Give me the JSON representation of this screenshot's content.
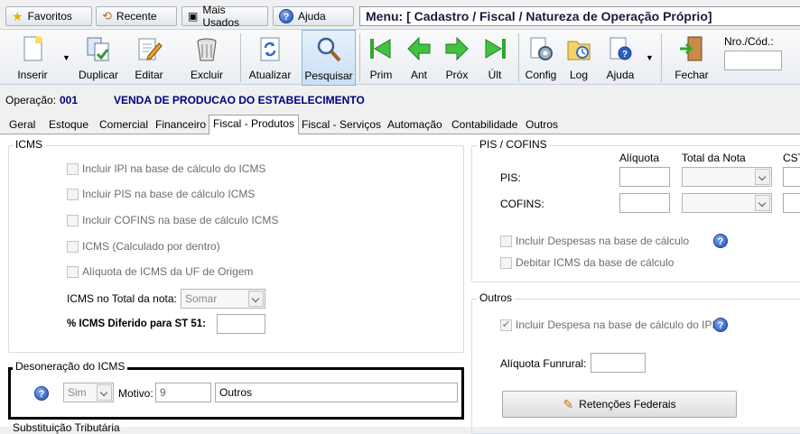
{
  "topbar": {
    "favoritos": "Favoritos",
    "recente": "Recente",
    "mais_usados": "Mais Usados",
    "ajuda": "Ajuda",
    "menu_title": "Menu: [ Cadastro / Fiscal / Natureza de Operação Próprio]"
  },
  "toolbar": {
    "inserir": "Inserir",
    "duplicar": "Duplicar",
    "editar": "Editar",
    "excluir": "Excluir",
    "atualizar": "Atualizar",
    "pesquisar": "Pesquisar",
    "prim": "Prim",
    "ant": "Ant",
    "prox": "Próx",
    "ult": "Últ",
    "config": "Config",
    "log": "Log",
    "ajuda": "Ajuda",
    "fechar": "Fechar",
    "nro_cod_label": "Nro./Cód.:",
    "nro_cod_value": ""
  },
  "operation": {
    "label": "Operação:",
    "code": "001",
    "description": "VENDA DE PRODUCAO DO ESTABELECIMENTO"
  },
  "tabs": [
    "Geral",
    "Estoque",
    "Comercial",
    "Financeiro",
    "Fiscal - Produtos",
    "Fiscal - Serviços",
    "Automação",
    "Contabilidade",
    "Outros"
  ],
  "selected_tab": "Fiscal - Produtos",
  "icms": {
    "title": "ICMS",
    "checks": [
      {
        "label": "Incluir IPI na base de cálculo do ICMS",
        "checked": false
      },
      {
        "label": "Incluir PIS na base de cálculo ICMS",
        "checked": false
      },
      {
        "label": "Incluir COFINS na base de cálculo ICMS",
        "checked": false
      },
      {
        "label": "ICMS (Calculado por dentro)",
        "checked": false
      },
      {
        "label": "Alíquota de ICMS da UF de Origem",
        "checked": false
      }
    ],
    "total_nota_label": "ICMS no Total da nota:",
    "total_nota_value": "Somar",
    "diferido_label": "% ICMS Diferido para ST 51:",
    "diferido_value": ""
  },
  "desoneracao": {
    "title": "Desoneração do ICMS",
    "sim_value": "Sim",
    "motivo_label": "Motivo:",
    "motivo_code": "9",
    "motivo_desc": "Outros"
  },
  "substituicao_title": "Substituição Tributária",
  "pis_cofins": {
    "title": "PIS / COFINS",
    "col_aliquota": "Alíquota",
    "col_total": "Total da Nota",
    "col_cst": "CST",
    "pis_label": "PIS:",
    "cofins_label": "COFINS:",
    "checks": [
      {
        "label": "Incluir Despesas na base de cálculo",
        "checked": false
      },
      {
        "label": "Debitar ICMS da base de cálculo",
        "checked": false
      }
    ]
  },
  "outros": {
    "title": "Outros",
    "incluir_despesa_label": "Incluir Despesa na base de cálculo do IPI",
    "incluir_despesa_checked": true,
    "funrural_label": "Alíquota Funrural:",
    "funrural_value": "",
    "retencoes_button": "Retenções Federais"
  },
  "colors": {
    "operation_blue": "#000080",
    "highlight_border": "#000000"
  }
}
